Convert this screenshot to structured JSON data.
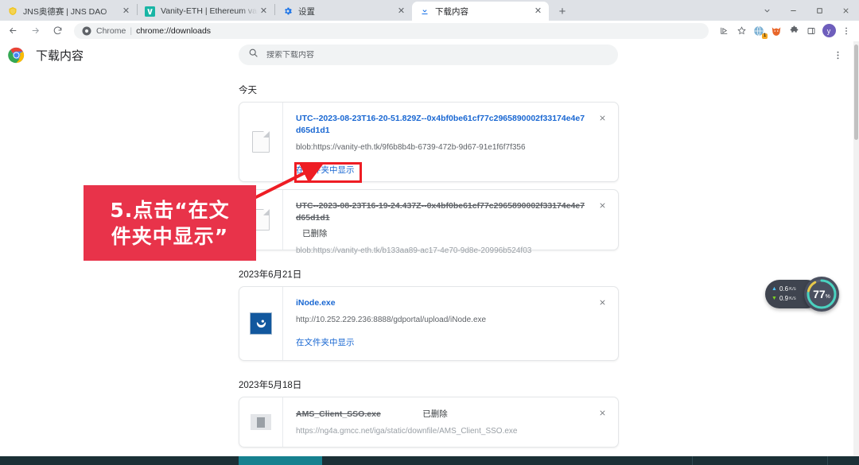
{
  "browser": {
    "tabs": [
      {
        "title": "JNS奥德赛 | JNS DAO",
        "favicon": "shield-icon",
        "active": false
      },
      {
        "title": "Vanity-ETH | Ethereum vanity a",
        "favicon": "v-logo-icon",
        "active": false
      },
      {
        "title": "设置",
        "favicon": "gear-icon",
        "active": false
      },
      {
        "title": "下载内容",
        "favicon": "download-icon",
        "active": true
      }
    ],
    "new_tab_label": "+",
    "close_label": "✕",
    "window_controls": {
      "expand": "⌄",
      "minimize": "—",
      "maximize": "□",
      "close": "✕"
    },
    "nav": {
      "back": "←",
      "forward": "→",
      "reload": "⟳"
    },
    "omnibox": {
      "origin": "Chrome",
      "divider": "|",
      "path": "chrome://downloads"
    },
    "toolbar_icons": [
      {
        "name": "share-icon",
        "glyph": "⇱"
      },
      {
        "name": "bookmark-star-icon",
        "glyph": "☆"
      },
      {
        "name": "extension-globe-icon",
        "glyph": "◕",
        "badge": "1"
      },
      {
        "name": "fox-extension-icon",
        "glyph": "✿"
      },
      {
        "name": "puzzle-extension-icon",
        "glyph": "✣"
      },
      {
        "name": "sidepanel-icon",
        "glyph": "▣"
      },
      {
        "name": "profile-avatar",
        "glyph": "y"
      },
      {
        "name": "chrome-menu-icon",
        "glyph": "⋮"
      }
    ]
  },
  "page": {
    "title": "下载内容",
    "search_placeholder": "搜索下载内容",
    "more_menu": "⋮",
    "groups": [
      {
        "date": "今天",
        "items": [
          {
            "icon": "generic-file-icon",
            "name": "UTC--2023-08-23T16-20-51.829Z--0x4bf0be61cf77c2965890002f33174e4e7d65d1d1",
            "url": "blob:https://vanity-eth.tk/9f6b8b4b-6739-472b-9d67-91e1f6f7f356",
            "action": "在文件夹中显示",
            "status": "",
            "removed": false
          },
          {
            "icon": "generic-file-icon",
            "name": "UTC--2023-08-23T16-19-24.437Z--0x4bf0be61cf77c2965890002f33174e4e7d65d1d1",
            "url": "blob:https://vanity-eth.tk/b133aa89-ac17-4e70-9d8e-20996b524f03",
            "action": "",
            "status": "已删除",
            "removed": true
          }
        ]
      },
      {
        "date": "2023年6月21日",
        "items": [
          {
            "icon": "inode-app-icon",
            "name": "iNode.exe",
            "url": "http://10.252.229.236:8888/gdportal/upload/iNode.exe",
            "action": "在文件夹中显示",
            "status": "",
            "removed": false
          }
        ]
      },
      {
        "date": "2023年5月18日",
        "items": [
          {
            "icon": "exe-file-icon",
            "name": "AMS_Client_SSO.exe",
            "url": "https://ng4a.gmcc.net/iga/static/downfile/AMS_Client_SSO.exe",
            "action": "",
            "status": "已删除",
            "removed": true
          }
        ]
      }
    ]
  },
  "annotation": {
    "line1": "5.点击“在文",
    "line2": "件夹中显示”",
    "color": "#e8334a",
    "highlight_color": "#ee1d24"
  },
  "speed_widget": {
    "upload": "0.6",
    "upload_unit": "K/s",
    "download": "0.9",
    "download_unit": "K/s",
    "percent": "77",
    "percent_unit": "%",
    "up_arrow": "▲",
    "down_arrow": "▼"
  }
}
